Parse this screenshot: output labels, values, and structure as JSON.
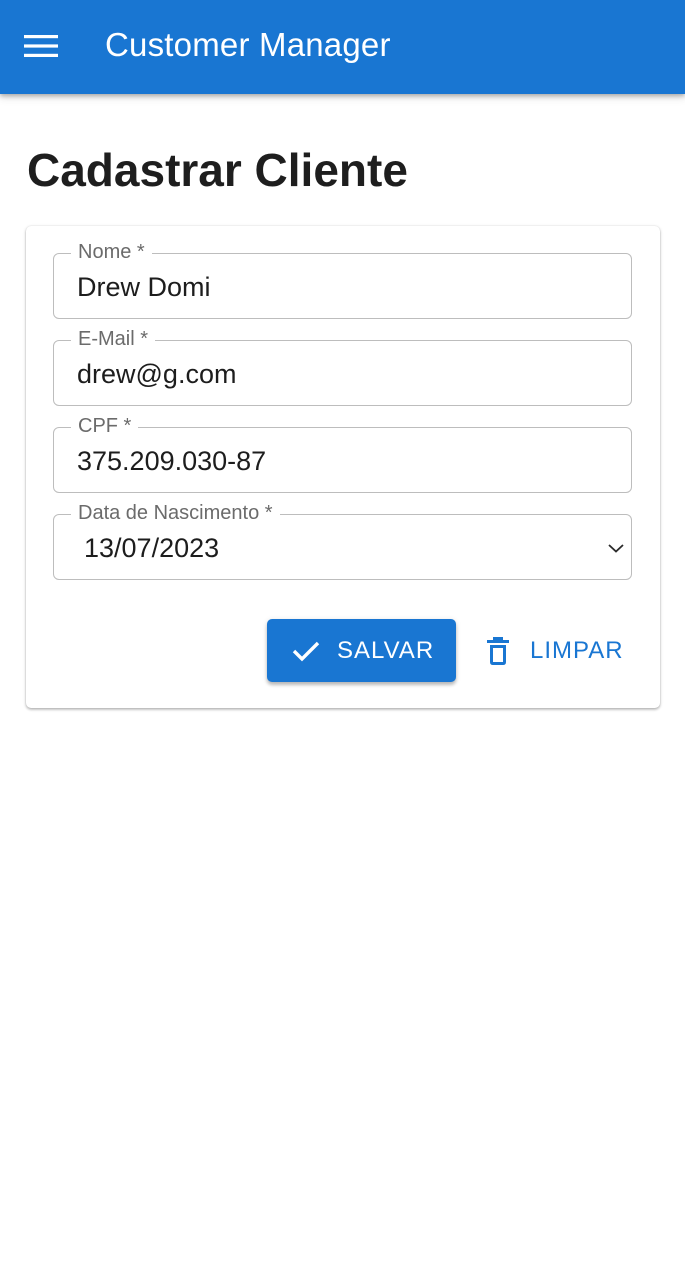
{
  "app_bar": {
    "title": "Customer Manager",
    "menu_icon": "hamburger-menu-icon",
    "background_color": "#1976d2"
  },
  "page": {
    "title": "Cadastrar Cliente"
  },
  "form": {
    "fields": [
      {
        "label": "Nome *",
        "value": "Drew Domi"
      },
      {
        "label": "E-Mail *",
        "value": "drew@g.com"
      },
      {
        "label": "CPF *",
        "value": "375.209.030-87"
      },
      {
        "label": "Data de Nascimento *",
        "value": "13/07/2023",
        "icon": "chevron-down-icon"
      }
    ],
    "actions": {
      "save_label": "SALVAR",
      "save_icon": "check-icon",
      "clear_label": "LIMPAR",
      "clear_icon": "trash-icon"
    }
  }
}
